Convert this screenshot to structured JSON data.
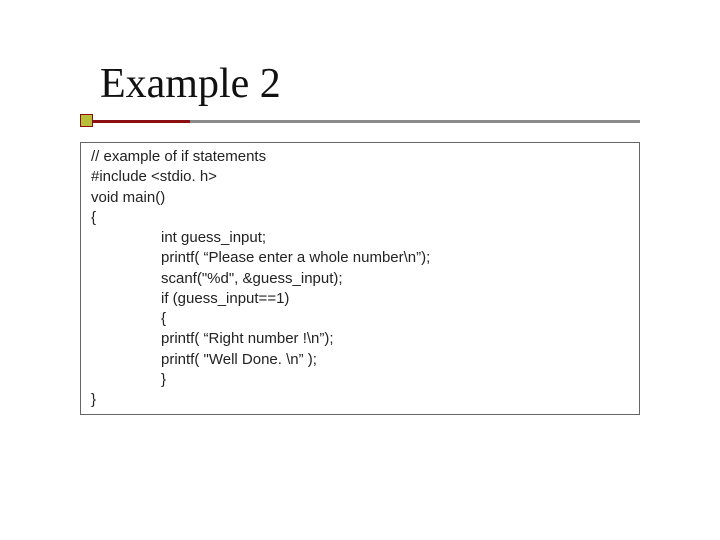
{
  "title": "Example 2",
  "code": {
    "l1": "// example of if statements",
    "l2": "#include <stdio. h>",
    "l3": "void main()",
    "l4": "{",
    "l5": "int guess_input;",
    "l6": "",
    "l7": "printf( “Please enter a whole number\\n”);",
    "l8": "scanf(\"%d\", &guess_input);",
    "l9": "if (guess_input==1)",
    "l10": "{",
    "l11": "printf( “Right number !\\n”);",
    "l12": "printf( \"Well Done. \\n” );",
    "l13": "}",
    "l14": "}"
  }
}
